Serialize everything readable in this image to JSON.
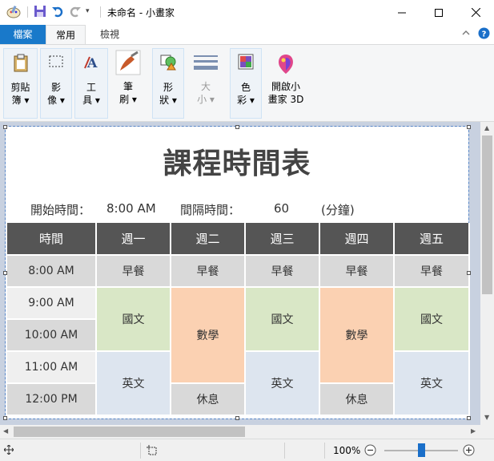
{
  "window": {
    "title": "未命名 - 小畫家"
  },
  "tabs": {
    "file": "檔案",
    "home": "常用",
    "view": "檢視"
  },
  "ribbon": {
    "clipboard": "剪貼\n簿 ▾",
    "image": "影\n像 ▾",
    "tools": "工\n具 ▾",
    "brushes": "筆\n刷 ▾",
    "shapes": "形\n狀 ▾",
    "size": "大\n小 ▾",
    "colors": "色\n彩 ▾",
    "paint3d": "開啟小\n畫家 3D"
  },
  "document": {
    "title": "課程時間表",
    "start_label": "開始時間：",
    "start_value": "8:00 AM",
    "interval_label": "間隔時間：",
    "interval_value": "60",
    "interval_unit": "(分鐘)",
    "headers": [
      "時間",
      "週一",
      "週二",
      "週三",
      "週四",
      "週五"
    ],
    "times": [
      "8:00 AM",
      "9:00 AM",
      "10:00 AM",
      "11:00 AM",
      "12:00 PM"
    ],
    "cells": {
      "breakfast": "早餐",
      "chinese": "國文",
      "math": "數學",
      "english": "英文",
      "rest": "休息"
    }
  },
  "status": {
    "zoom": "100%",
    "zoom_level": 0.5
  },
  "colors": {
    "file_tab": "#1979ca",
    "table_header": "#555555",
    "green": "#d9e7c6",
    "orange": "#fbd1b2",
    "blue": "#dde5ef",
    "gray": "#d9d9d9"
  }
}
